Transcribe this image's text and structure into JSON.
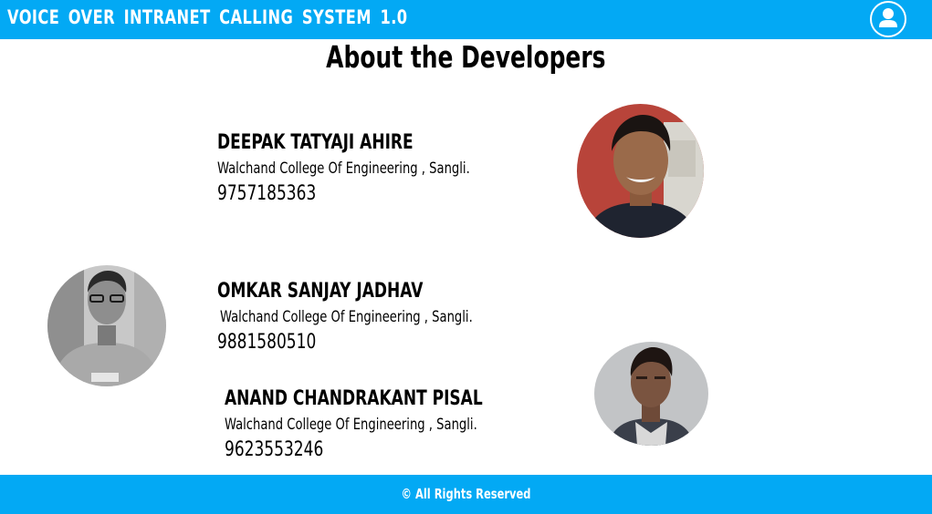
{
  "header": {
    "app_title": "VOICE OVER INTRANET CALLING SYSTEM 1.0",
    "user_icon": "user-icon",
    "color": "#03a9f4"
  },
  "page": {
    "title": "About the Developers"
  },
  "developers": [
    {
      "name": "DEEPAK TATYAJI AHIRE",
      "college": "Walchand College Of  Engineering , Sangli.",
      "phone": "9757185363"
    },
    {
      "name": "OMKAR SANJAY JADHAV",
      "college": "Walchand College Of  Engineering , Sangli.",
      "phone": "9881580510"
    },
    {
      "name": "ANAND CHANDRAKANT PISAL",
      "college": "Walchand College Of  Engineering , Sangli.",
      "phone": "9623553246"
    }
  ],
  "footer": {
    "text": "© All Rights Reserved"
  }
}
